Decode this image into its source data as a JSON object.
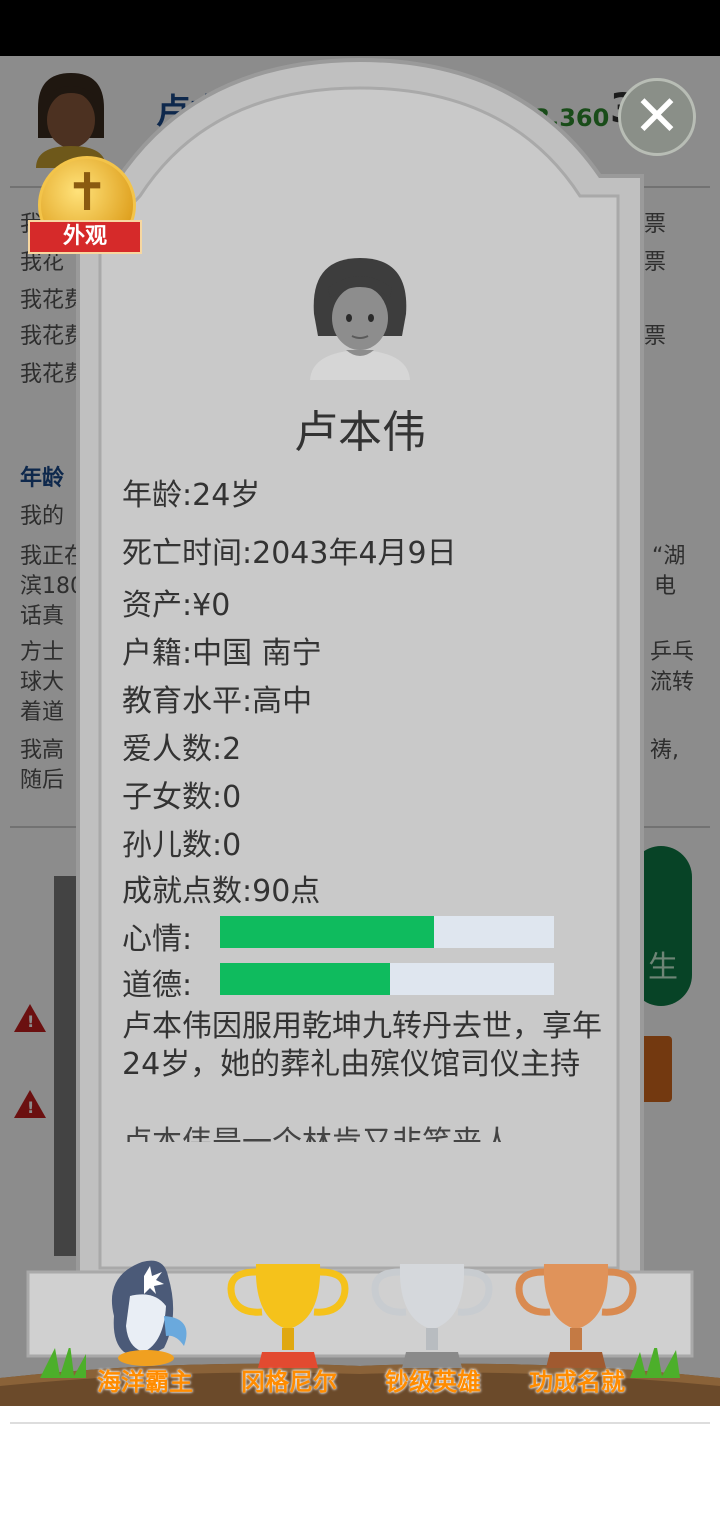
{
  "background": {
    "player_name": "卢本伟",
    "money": "143,360",
    "log_lines": [
      "我",
      "我花",
      "我花费",
      "我花费",
      "我花费"
    ],
    "right_fragments": [
      "票",
      "票",
      "票"
    ],
    "age_heading": "年龄",
    "lines2": [
      "我的",
      "我正在",
      "滨180",
      "话真",
      "方士",
      "球大",
      "着道",
      "我高",
      "随后"
    ],
    "right2": [
      "“湖",
      "电",
      "乒乓",
      "流转",
      "祷,"
    ],
    "green_button_label": "生"
  },
  "tombstone": {
    "name": "卢本伟",
    "fields": [
      {
        "label": "年龄:",
        "value": "24岁"
      },
      {
        "label": "死亡时间:",
        "value": "2043年4月9日"
      },
      {
        "label": "资产:",
        "value": "¥0"
      },
      {
        "label": "户籍:",
        "value": "中国 南宁"
      },
      {
        "label": "教育水平:",
        "value": "高中"
      },
      {
        "label": "爱人数:",
        "value": "2"
      },
      {
        "label": "子女数:",
        "value": "0"
      },
      {
        "label": "孙儿数:",
        "value": "0"
      },
      {
        "label": "成就点数:",
        "value": "90点"
      }
    ],
    "mood_label": "心情:",
    "mood_level": 0.64,
    "morality_label": "道德:",
    "morality_level": 0.51,
    "epitaph": "卢本伟因服用乾坤九转丹去世，享年24岁，她的葬礼由殡仪馆司仪主持",
    "epitaph_cont": "卢本伟是一个林肯又非笑来人"
  },
  "appearance_badge": {
    "label": "外观",
    "icon": "cross-icon"
  },
  "close_button": {
    "icon": "close-icon",
    "symbol": "✕"
  },
  "achievements": [
    {
      "label": "海洋霸主",
      "icon": "whale-icon"
    },
    {
      "label": "冈格尼尔",
      "icon": "gold-trophy-icon"
    },
    {
      "label": "钞级英雄",
      "icon": "silver-trophy-icon"
    },
    {
      "label": "功成名就",
      "icon": "bronze-trophy-icon"
    }
  ],
  "colors": {
    "bar_fill": "#0fbb5e",
    "bar_track": "#dfe6ef",
    "stone": "#c6c6c6",
    "label_orange": "#ff8c00"
  }
}
